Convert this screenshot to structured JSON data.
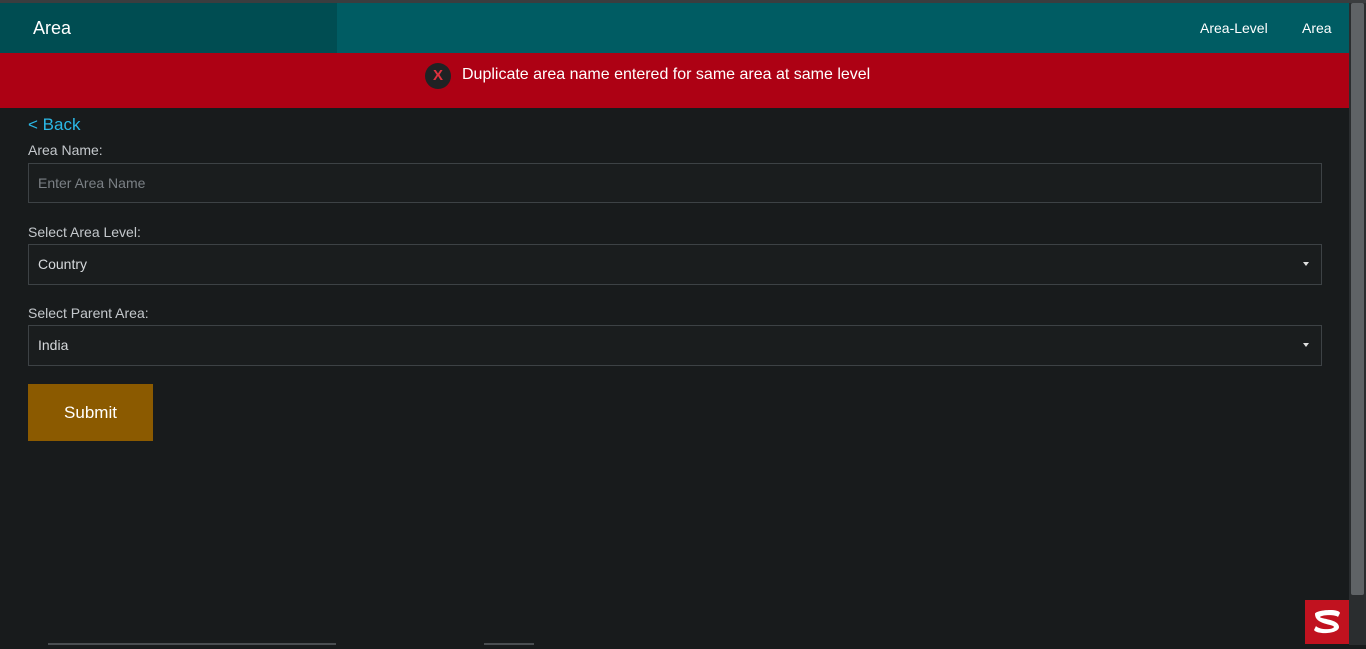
{
  "header": {
    "title": "Area",
    "nav": [
      {
        "label": "Area-Level"
      },
      {
        "label": "Area"
      }
    ]
  },
  "alert": {
    "icon_text": "X",
    "message": "Duplicate area name entered for same area at same level",
    "color": "#ad0114"
  },
  "form": {
    "back_label": "< Back",
    "area_name": {
      "label": "Area Name:",
      "placeholder": "Enter Area Name",
      "value": ""
    },
    "area_level": {
      "label": "Select Area Level:",
      "selected": "Country"
    },
    "parent_area": {
      "label": "Select Parent Area:",
      "selected": "India"
    },
    "submit_label": "Submit"
  },
  "colors": {
    "header_bg": "#005c63",
    "brand_bg": "#004d52",
    "page_bg": "#181b1c",
    "link": "#2bb8e6",
    "submit_bg": "#8b5a00"
  }
}
